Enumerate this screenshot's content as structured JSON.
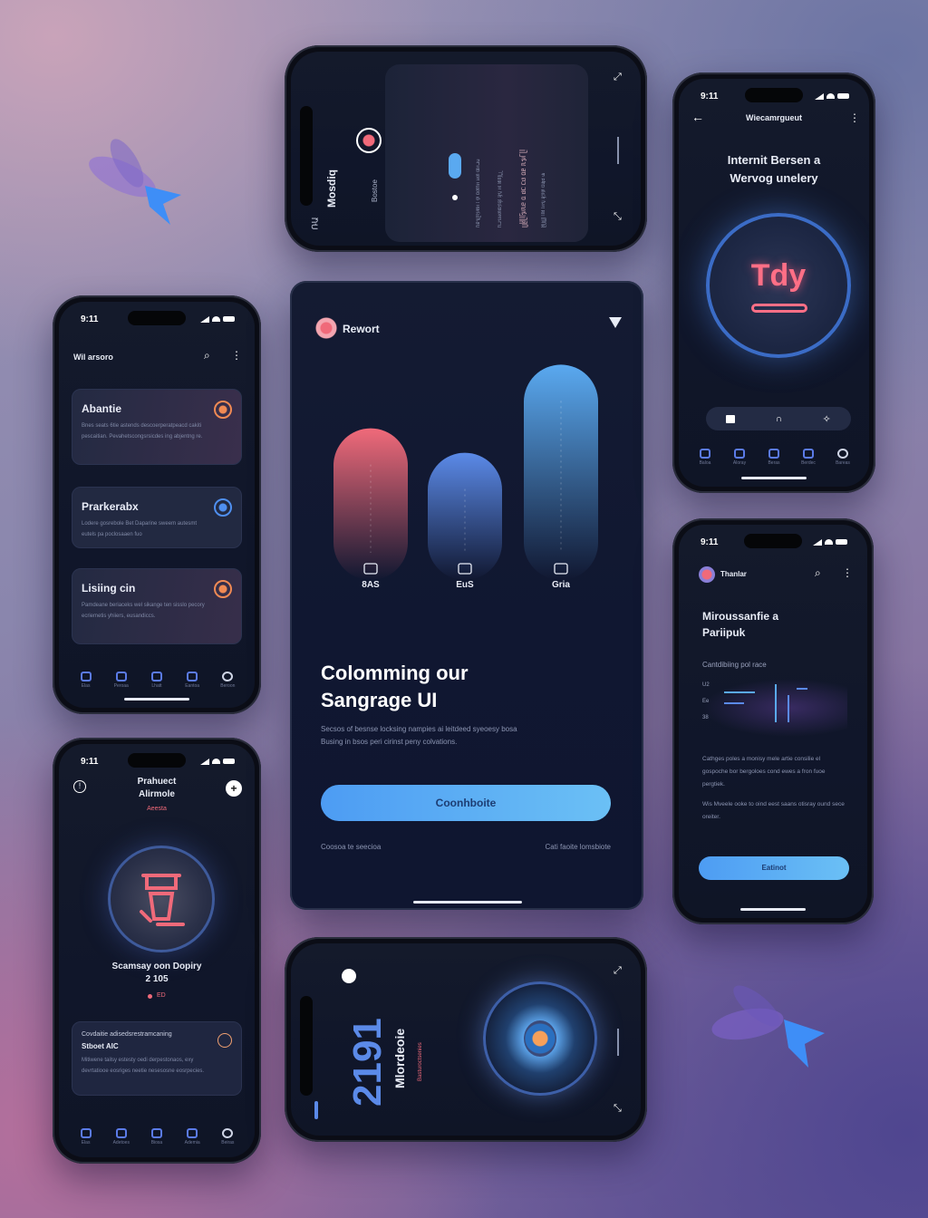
{
  "decor": {
    "accent": "#4a8fff",
    "pink": "#f06a7a",
    "blue": "#5aa9f0"
  },
  "phone_top": {
    "heading": "Mosdiq",
    "subheading": "Bostoe",
    "side_label": "ՌԱ",
    "columns": [
      "ᥰᥱᥡᥫᥬᥭᥤᥢ ᥣ ᥞ ᥝᥖᥒᥢ ᥕᥖ ᥗᥢᥘᥙ",
      "ᥒᥘᥔᥕᥖᥗᥟᥠᥣ ᥠᥡ ᥢᥣ ᥤᥥᥦᥧ ᥨ",
      "ᥩᥪᥫᥬᥭᥰᥱ ᥲ ᥳᥴ ᥵ᥴᥳ ᥲᥱ ᥰᥭᥬ ᥫ",
      "ᥪᥩᥨᥧᥦ ᥥᥤ ᥣᥢᥡ ᥠᥟᥞ ᥝᥜᥛ ᥚ"
    ]
  },
  "phone_left1": {
    "time": "9:11",
    "title": "Wil arsoro",
    "cards": [
      {
        "title": "Abantie",
        "desc": "Bnes seats 6tie astends descoerperatpeacd cakiti pescaitian. Pevahetscongsrsicdes ing abjentng re."
      },
      {
        "title": "Prarkerabx",
        "desc": "Lodere gosrebole Bet Daparine sweem autesmt eutels pa poclosaaen fuo"
      },
      {
        "title": "Lisiing cin",
        "desc": "Pamdeane beriaceks wel sikange ten sisslo pecory ecriemetis yhiiers, eusandiccs."
      }
    ],
    "nav": [
      "Elas",
      "Peroaa",
      "Lhatt",
      "Eantoa",
      "Beroon"
    ]
  },
  "phone_left2": {
    "time": "9:11",
    "title_line1": "Prahuect",
    "title_line2": "Alirmole",
    "tag": "Aeesta",
    "caption_line1": "Scamsay oon Dopiry",
    "caption_line2": "2 105",
    "status": "ED",
    "card_title": "Covdaitie adisedsrestramcaning",
    "card_subtitle": "Stboet AIC",
    "card_desc": "Mitiwene tailsy estesty oedi derpestonaos, exy devrtatiooe eosriges neetie nesesosne eosrpecies.",
    "nav": [
      "Elas",
      "Adetoes",
      "Biosa",
      "Ademia",
      "Beiras"
    ]
  },
  "phone_center": {
    "brand": "Rewort",
    "chart_data": {
      "type": "bar",
      "categories": [
        "8AS",
        "EuS",
        "Gria"
      ],
      "values": [
        62,
        52,
        88
      ],
      "ylim": [
        0,
        100
      ],
      "colors": [
        "#f06a7a",
        "#5b8ae8",
        "#5aa9f0"
      ]
    },
    "headline_line1": "Colomming our",
    "headline_line2": "Sangrage UI",
    "body_line1": "Secsos of besnse locksing nampies ai leitdeed syeoesy bosa",
    "body_line2": "Busing in bsos peri cirinst peny colvations.",
    "cta": "Coonhboite",
    "link_left": "Coosoa te seecioa",
    "link_right": "Cati faoite lomsbiote"
  },
  "phone_right1": {
    "time": "9:11",
    "title": "Wiecamrgueut",
    "headline_line1": "Internit Bersen a",
    "headline_line2": "Wervog unelery",
    "emblem": "Tdy",
    "nav": [
      "Baloa",
      "Aloray",
      "Beras",
      "Berdec",
      "Bareas"
    ]
  },
  "phone_right2": {
    "time": "9:11",
    "brand": "Thanlar",
    "headline_line1": "Miroussanfie a",
    "headline_line2": "Pariipuk",
    "section": "Cantdibiing pol race",
    "mini_labels": [
      "U2",
      "Ee",
      "38"
    ],
    "para1": "Cathges poles a monisy mele artie consilie el gospoche bor bergoloes cond ewes a fron fuoe pergtiek.",
    "para2": "Wis Mveele ooke to oind eest saans otisray ound sece oreiter.",
    "cta": "Eatinot"
  },
  "phone_bottom": {
    "big_number": "2191",
    "heading": "Mlordeoie",
    "subheading": "Basturoctsenies"
  }
}
